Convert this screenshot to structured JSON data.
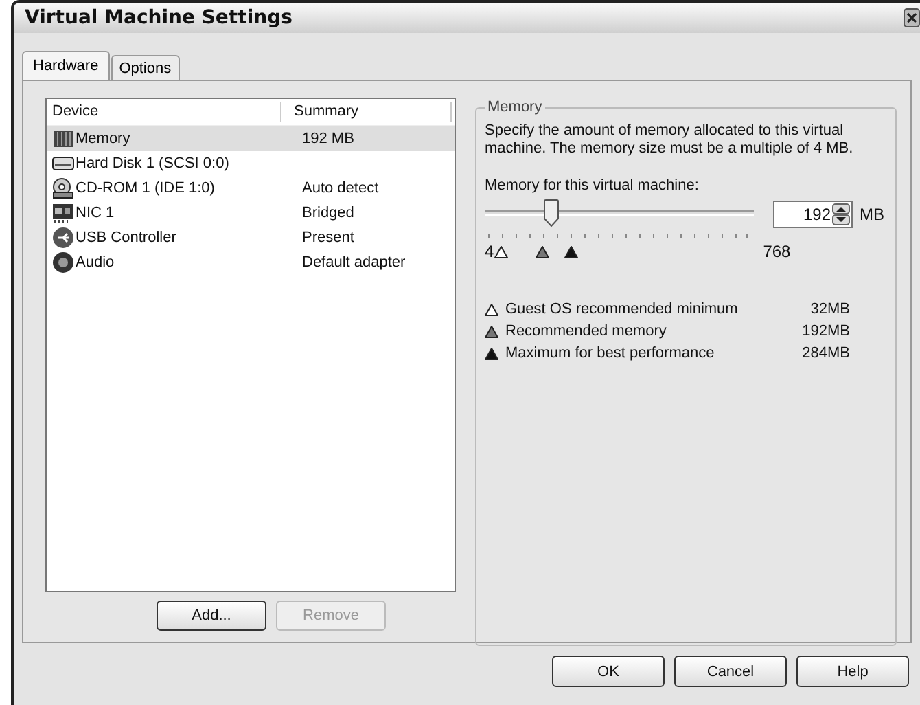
{
  "window": {
    "title": "Virtual Machine Settings"
  },
  "tabs": [
    {
      "label": "Hardware",
      "selected": true
    },
    {
      "label": "Options",
      "selected": false
    }
  ],
  "devices": {
    "columns": [
      "Device",
      "Summary"
    ],
    "rows": [
      {
        "kind": "memory",
        "device": "Memory",
        "summary": "192 MB",
        "selected": true
      },
      {
        "kind": "disk",
        "device": "Hard Disk 1 (SCSI 0:0)",
        "summary": "",
        "selected": false
      },
      {
        "kind": "cdrom",
        "device": "CD-ROM 1 (IDE 1:0)",
        "summary": "Auto detect",
        "selected": false
      },
      {
        "kind": "nic",
        "device": "NIC 1",
        "summary": "Bridged",
        "selected": false
      },
      {
        "kind": "usb",
        "device": "USB Controller",
        "summary": "Present",
        "selected": false
      },
      {
        "kind": "audio",
        "device": "Audio",
        "summary": "Default adapter",
        "selected": false
      }
    ]
  },
  "list_buttons": [
    {
      "label": "Add...",
      "disabled": false
    },
    {
      "label": "Remove",
      "disabled": true
    }
  ],
  "memory": {
    "title": "Memory",
    "description": "Specify the amount of memory allocated to this virtual machine. The memory size must be a multiple of 4 MB.",
    "slider_label": "Memory for this virtual machine:",
    "level": 0.246,
    "min_label": "4",
    "max_label": "768",
    "value": "192",
    "unit": "MB",
    "legend": [
      {
        "kind": "minimum",
        "label": "Guest OS recommended minimum",
        "value": "32MB"
      },
      {
        "kind": "recommended",
        "label": "Recommended memory",
        "value": "192MB"
      },
      {
        "kind": "maximum",
        "label": "Maximum for best performance",
        "value": "284MB"
      }
    ]
  },
  "buttons": [
    "OK",
    "Cancel",
    "Help"
  ]
}
